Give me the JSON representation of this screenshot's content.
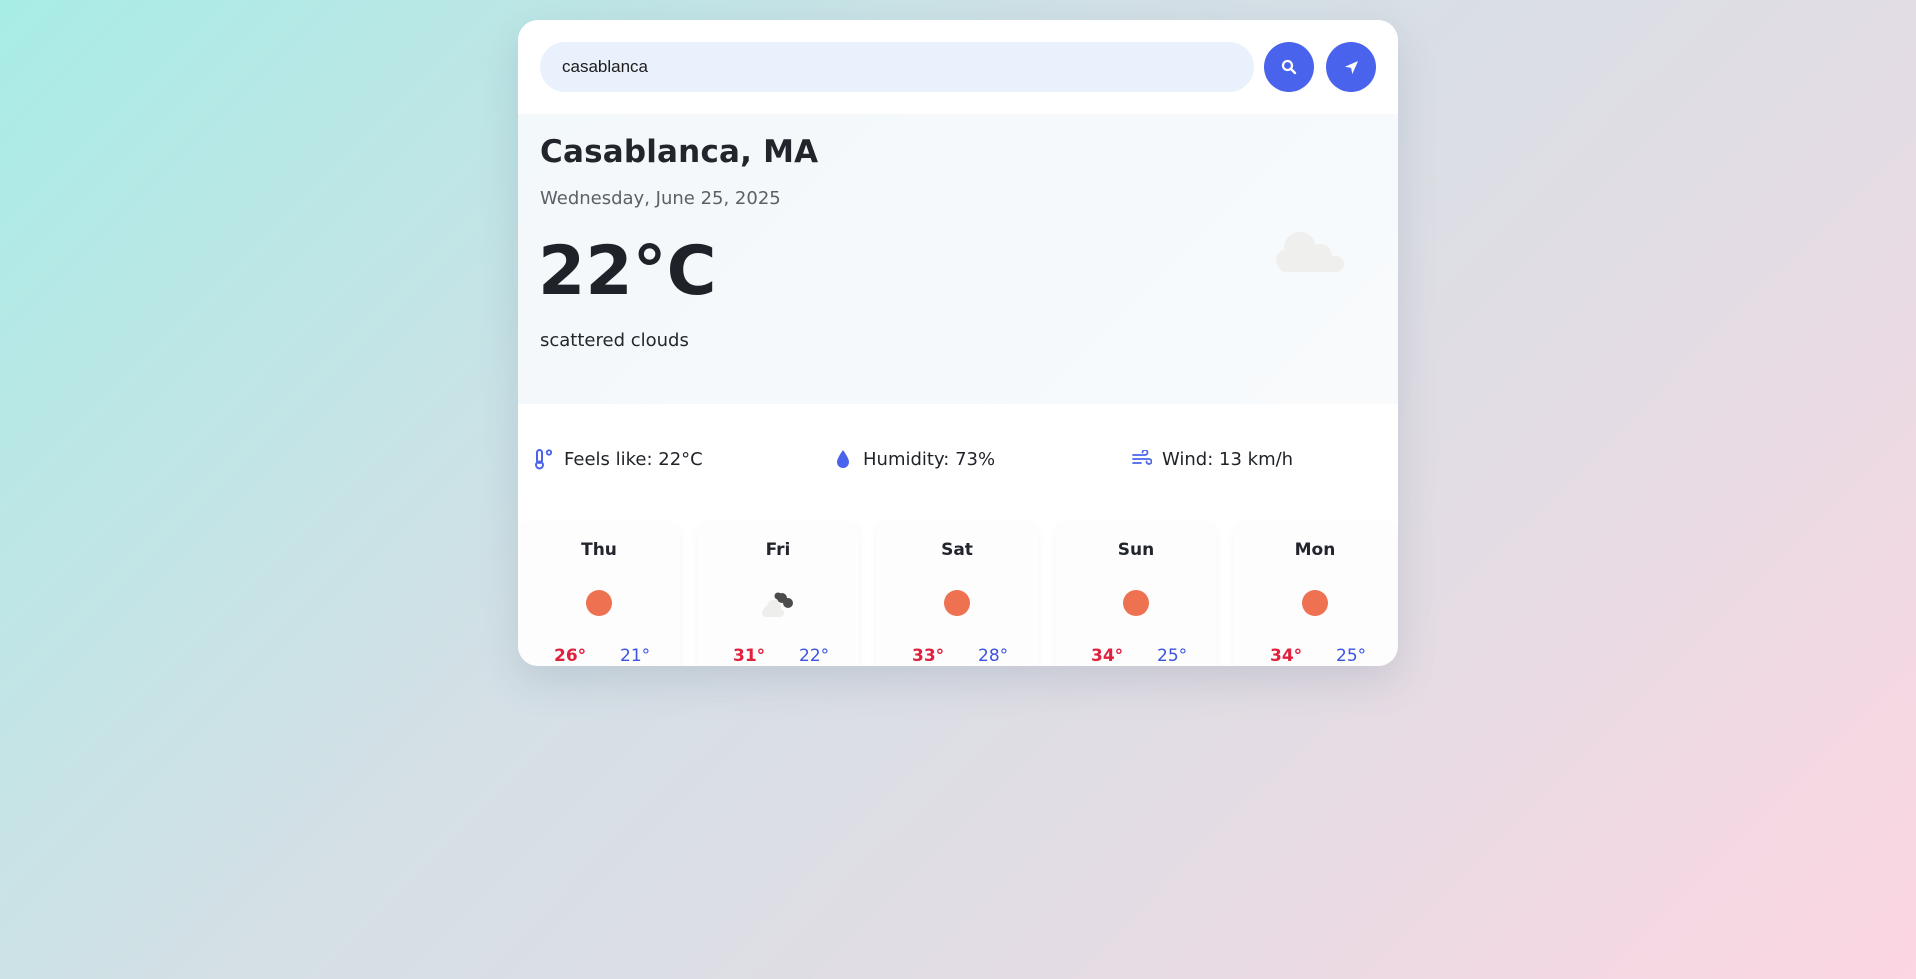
{
  "search": {
    "value": "casablanca",
    "search_icon": "search-icon",
    "locate_icon": "location-arrow-icon"
  },
  "current": {
    "city": "Casablanca, MA",
    "date": "Wednesday, June 25, 2025",
    "temperature": "22°C",
    "description": "scattered clouds",
    "icon": "cloud-icon"
  },
  "stats": {
    "feels_like": "Feels like: 22°C",
    "humidity": "Humidity: 73%",
    "wind": "Wind: 13 km/h"
  },
  "forecast": [
    {
      "day": "Thu",
      "icon": "sun-icon",
      "high": "26°",
      "low": "21°"
    },
    {
      "day": "Fri",
      "icon": "cloudy-icon",
      "high": "31°",
      "low": "22°"
    },
    {
      "day": "Sat",
      "icon": "sun-icon",
      "high": "33°",
      "low": "28°"
    },
    {
      "day": "Sun",
      "icon": "sun-icon",
      "high": "34°",
      "low": "25°"
    },
    {
      "day": "Mon",
      "icon": "sun-icon",
      "high": "34°",
      "low": "25°"
    }
  ],
  "colors": {
    "accent": "#4a63ec",
    "high_temp": "#e0213d",
    "low_temp": "#3b53e0",
    "sun": "#ee7151"
  }
}
